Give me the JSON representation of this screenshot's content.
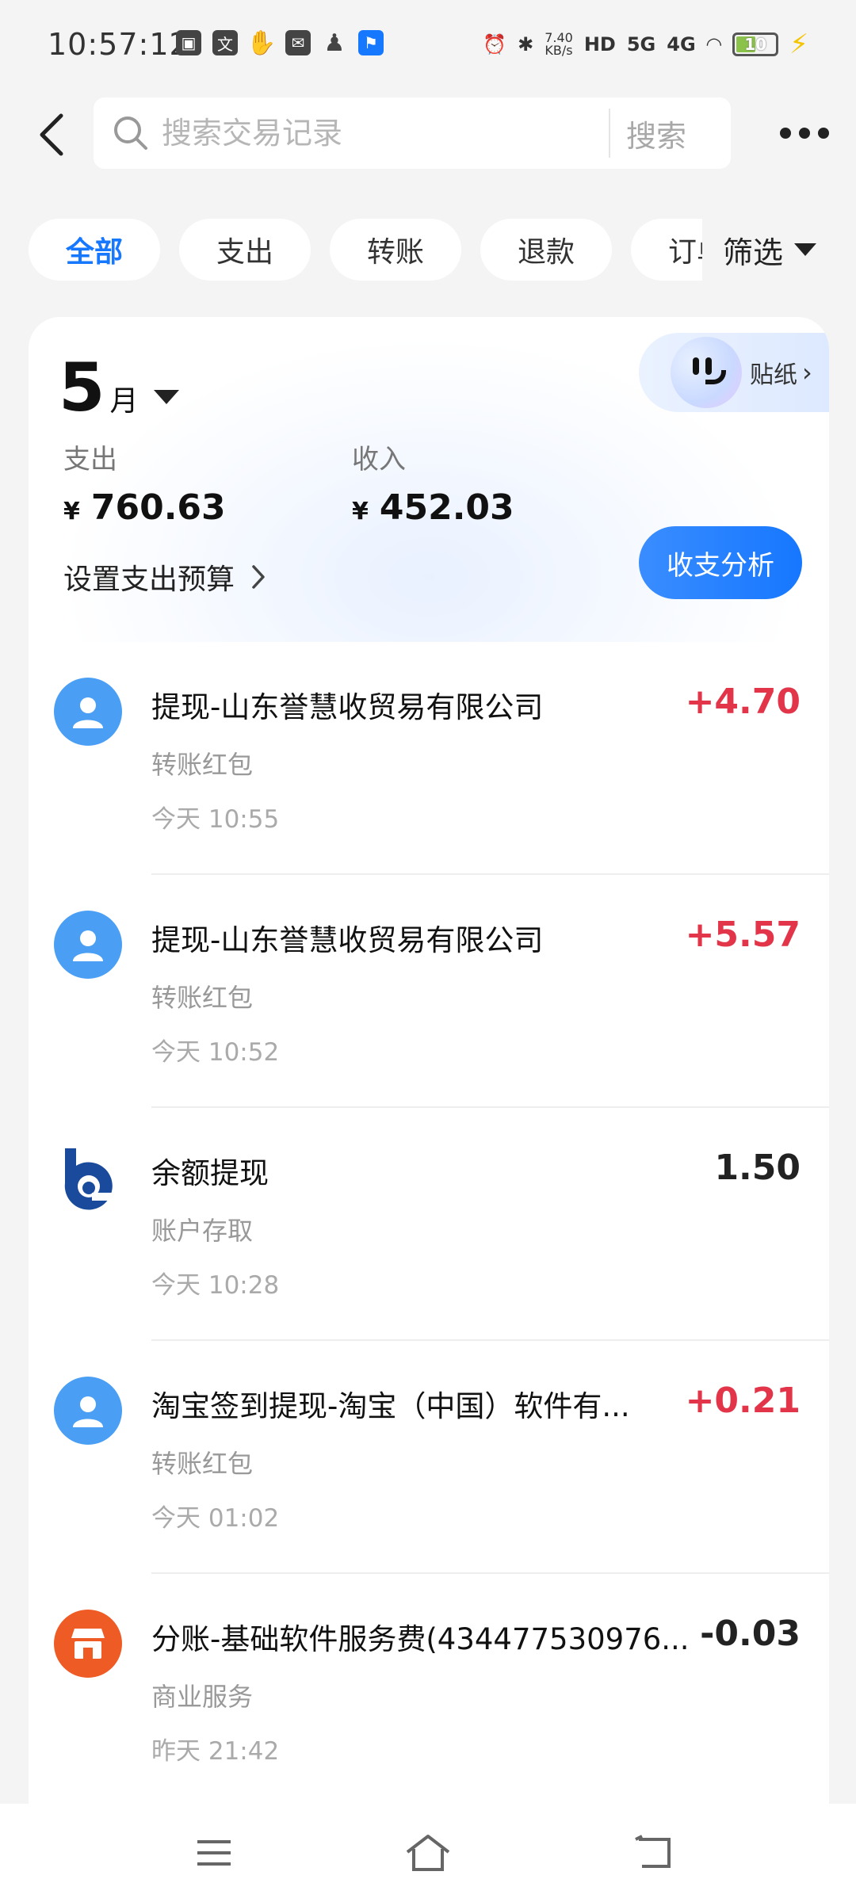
{
  "status": {
    "time": "10:57:12",
    "net_speed_value": "7.40",
    "net_speed_unit": "KB/s",
    "hd": "HD",
    "signal_5g": "5G",
    "signal_4g": "4G",
    "battery": "10"
  },
  "search": {
    "placeholder": "搜索交易记录",
    "button": "搜索"
  },
  "filters": {
    "chips": [
      "全部",
      "支出",
      "转账",
      "退款",
      "订单"
    ],
    "active": "全部",
    "filter_label": "筛选"
  },
  "summary": {
    "month_num": "5",
    "month_unit": "月",
    "sticker_label": "贴纸",
    "expense_label": "支出",
    "expense_currency": "¥",
    "expense_value": "760.63",
    "income_label": "收入",
    "income_currency": "¥",
    "income_value": "452.03",
    "budget_label": "设置支出预算",
    "analysis_label": "收支分析"
  },
  "transactions": [
    {
      "title": "提现-山东誉慧收贸易有限公司",
      "category": "转账红包",
      "time": "今天 10:55",
      "amount": "+4.70",
      "icon": "person-icon"
    },
    {
      "title": "提现-山东誉慧收贸易有限公司",
      "category": "转账红包",
      "time": "今天 10:52",
      "amount": "+5.57",
      "icon": "person-icon"
    },
    {
      "title": "余额提现",
      "category": "账户存取",
      "time": "今天 10:28",
      "amount": "1.50",
      "icon": "bank-logo-icon"
    },
    {
      "title": "淘宝签到提现-淘宝（中国）软件有...",
      "category": "转账红包",
      "time": "今天 01:02",
      "amount": "+0.21",
      "icon": "person-icon"
    },
    {
      "title": "分账-基础软件服务费(434477530976...",
      "category": "商业服务",
      "time": "昨天 21:42",
      "amount": "-0.03",
      "icon": "shop-icon"
    }
  ],
  "colors": {
    "accent": "#1677ff",
    "income": "#e2354a",
    "person_avatar": "#4a9ff5",
    "shop_avatar": "#ef5b25"
  }
}
